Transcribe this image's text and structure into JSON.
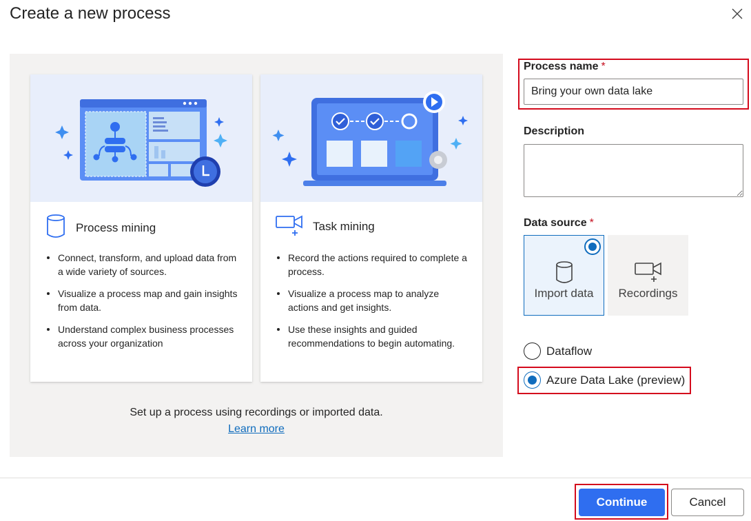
{
  "dialog": {
    "title": "Create a new process",
    "close_icon": "close-icon"
  },
  "cards": [
    {
      "title": "Process mining",
      "icon": "database-cylinder-icon",
      "bullets": [
        "Connect, transform, and upload data from a wide variety of sources.",
        "Visualize a process map and gain insights from data.",
        "Understand complex business processes across your organization"
      ]
    },
    {
      "title": "Task mining",
      "icon": "video-recording-icon",
      "bullets": [
        "Record the actions required to complete a process.",
        "Visualize a process map to analyze actions and get insights.",
        "Use these insights and guided recommendations to begin automating."
      ]
    }
  ],
  "setup": {
    "text": "Set up a process using recordings or imported data.",
    "link": "Learn more"
  },
  "form": {
    "process_name": {
      "label": "Process name",
      "required_mark": "*",
      "value": "Bring your own data lake"
    },
    "description": {
      "label": "Description",
      "value": ""
    },
    "data_source": {
      "label": "Data source",
      "required_mark": "*",
      "tiles": [
        {
          "label": "Import data",
          "icon": "database-cylinder-icon",
          "selected": true
        },
        {
          "label": "Recordings",
          "icon": "video-recording-icon",
          "selected": false
        }
      ],
      "options": [
        {
          "label": "Dataflow",
          "checked": false
        },
        {
          "label": "Azure Data Lake (preview)",
          "checked": true
        }
      ]
    }
  },
  "footer": {
    "continue_label": "Continue",
    "cancel_label": "Cancel"
  },
  "colors": {
    "accent": "#0f6cbd",
    "primary_button": "#2f6ef0",
    "highlight": "#d40a1c",
    "panel_bg": "#f3f2f1"
  }
}
